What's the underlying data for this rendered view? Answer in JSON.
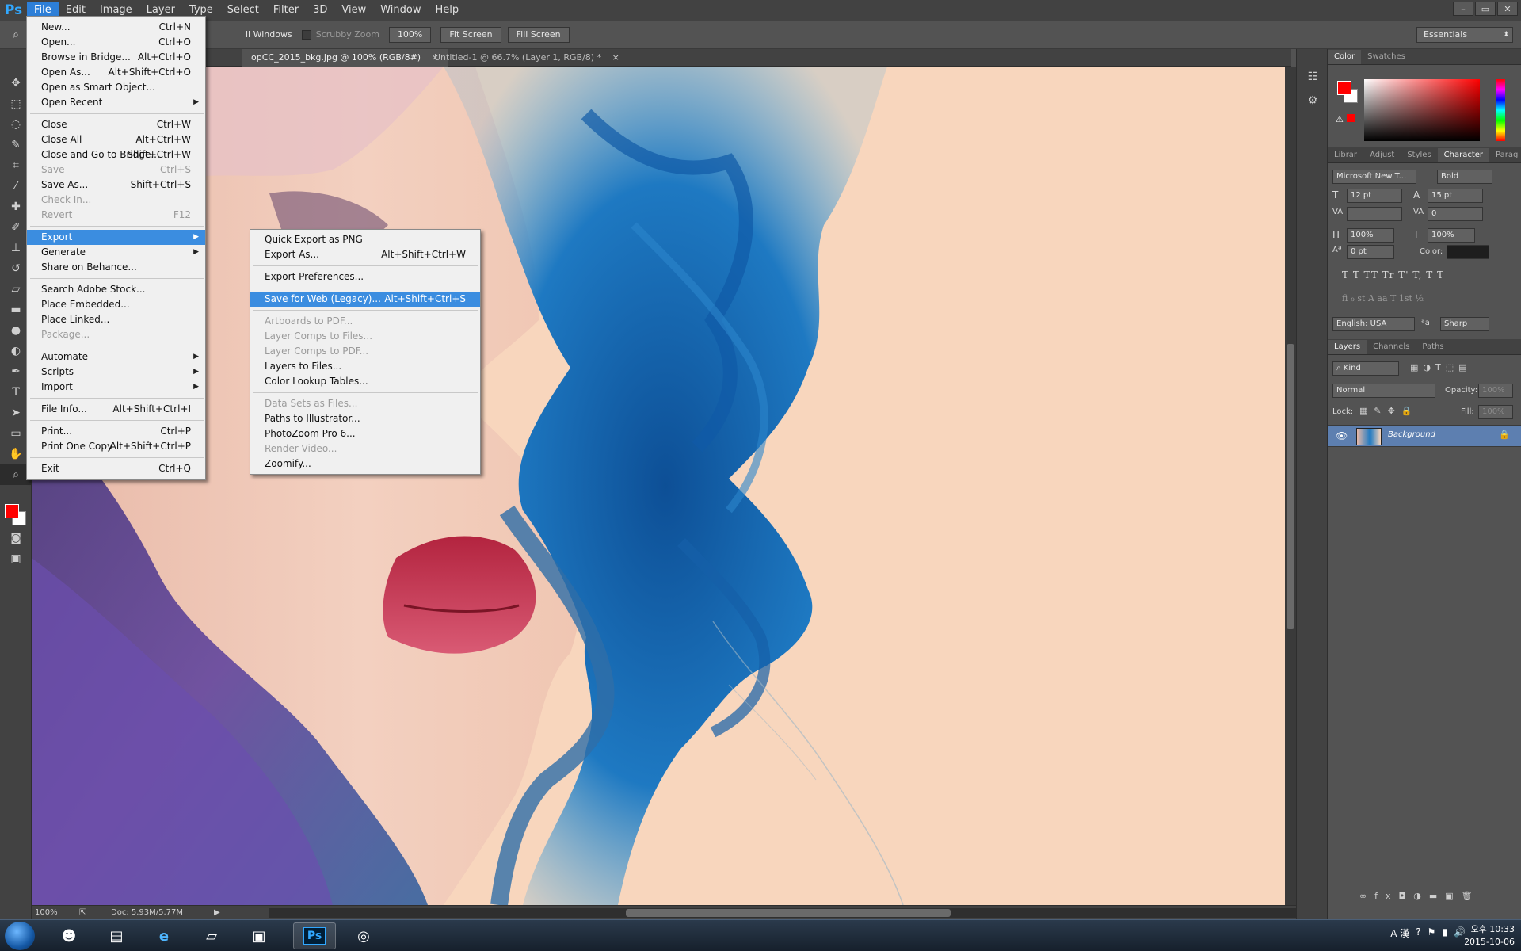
{
  "app": {
    "logo": "Ps"
  },
  "menubar": {
    "items": [
      "File",
      "Edit",
      "Image",
      "Layer",
      "Type",
      "Select",
      "Filter",
      "3D",
      "View",
      "Window",
      "Help"
    ],
    "window_buttons": [
      "–",
      "▭",
      "✕"
    ]
  },
  "options": {
    "all_windows": "ll Windows",
    "scrubby_zoom": "Scrubby Zoom",
    "zoom_btn": "100%",
    "fit_screen": "Fit Screen",
    "fill_screen": "Fill Screen",
    "workspace": "Essentials"
  },
  "tabs": [
    {
      "label": "opCC_2015_bkg.jpg @ 100% (RGB/8#)",
      "close": "×"
    },
    {
      "label": "Untitled-1 @ 66.7% (Layer 1, RGB/8) *",
      "close": "×"
    }
  ],
  "status": {
    "zoom": "100%",
    "doc": "Doc: 5.93M/5.77M"
  },
  "file_menu": [
    {
      "label": "New...",
      "shortcut": "Ctrl+N"
    },
    {
      "label": "Open...",
      "shortcut": "Ctrl+O"
    },
    {
      "label": "Browse in Bridge...",
      "shortcut": "Alt+Ctrl+O"
    },
    {
      "label": "Open As...",
      "shortcut": "Alt+Shift+Ctrl+O"
    },
    {
      "label": "Open as Smart Object...",
      "shortcut": ""
    },
    {
      "label": "Open Recent",
      "shortcut": ""
    },
    {
      "label": "Close",
      "shortcut": "Ctrl+W"
    },
    {
      "label": "Close All",
      "shortcut": "Alt+Ctrl+W"
    },
    {
      "label": "Close and Go to Bridge...",
      "shortcut": "Shift+Ctrl+W"
    },
    {
      "label": "Save",
      "shortcut": "Ctrl+S"
    },
    {
      "label": "Save As...",
      "shortcut": "Shift+Ctrl+S"
    },
    {
      "label": "Check In...",
      "shortcut": ""
    },
    {
      "label": "Revert",
      "shortcut": "F12"
    },
    {
      "label": "Export",
      "shortcut": ""
    },
    {
      "label": "Generate",
      "shortcut": ""
    },
    {
      "label": "Share on Behance...",
      "shortcut": ""
    },
    {
      "label": "Search Adobe Stock...",
      "shortcut": ""
    },
    {
      "label": "Place Embedded...",
      "shortcut": ""
    },
    {
      "label": "Place Linked...",
      "shortcut": ""
    },
    {
      "label": "Package...",
      "shortcut": ""
    },
    {
      "label": "Automate",
      "shortcut": ""
    },
    {
      "label": "Scripts",
      "shortcut": ""
    },
    {
      "label": "Import",
      "shortcut": ""
    },
    {
      "label": "File Info...",
      "shortcut": "Alt+Shift+Ctrl+I"
    },
    {
      "label": "Print...",
      "shortcut": "Ctrl+P"
    },
    {
      "label": "Print One Copy",
      "shortcut": "Alt+Shift+Ctrl+P"
    },
    {
      "label": "Exit",
      "shortcut": "Ctrl+Q"
    }
  ],
  "export_menu": [
    {
      "label": "Quick Export as PNG",
      "shortcut": ""
    },
    {
      "label": "Export As...",
      "shortcut": "Alt+Shift+Ctrl+W"
    },
    {
      "label": "Export Preferences...",
      "shortcut": ""
    },
    {
      "label": "Save for Web (Legacy)...",
      "shortcut": "Alt+Shift+Ctrl+S"
    },
    {
      "label": "Artboards to PDF...",
      "shortcut": ""
    },
    {
      "label": "Layer Comps to Files...",
      "shortcut": ""
    },
    {
      "label": "Layer Comps to PDF...",
      "shortcut": ""
    },
    {
      "label": "Layers to Files...",
      "shortcut": ""
    },
    {
      "label": "Color Lookup Tables...",
      "shortcut": ""
    },
    {
      "label": "Data Sets as Files...",
      "shortcut": ""
    },
    {
      "label": "Paths to Illustrator...",
      "shortcut": ""
    },
    {
      "label": "PhotoZoom Pro 6...",
      "shortcut": ""
    },
    {
      "label": "Render Video...",
      "shortcut": ""
    },
    {
      "label": "Zoomify...",
      "shortcut": ""
    }
  ],
  "panels": {
    "color_tabs": [
      "Color",
      "Swatches"
    ],
    "char_tabs": [
      "Librar",
      "Adjust",
      "Styles",
      "Character",
      "Parag"
    ],
    "font_family": "Microsoft New T...",
    "font_style": "Bold",
    "font_size": "12 pt",
    "leading": "15 pt",
    "tracking": "0",
    "vscale": "100%",
    "hscale": "100%",
    "baseline": "0 pt",
    "color_label": "Color:",
    "type_styles": "T  T  TT  Tr  T'  T,  T  T",
    "ot_features": "fi  ℴ  st  A  aa  T  1st  ½",
    "language": "English: USA",
    "aa_label": "ªa",
    "antialias": "Sharp",
    "layer_tabs": [
      "Layers",
      "Channels",
      "Paths"
    ],
    "kind": "Kind",
    "blend": "Normal",
    "opacity_label": "Opacity:",
    "opacity": "100%",
    "lock_label": "Lock:",
    "fill_label": "Fill:",
    "fill": "100%",
    "layer_name": "Background"
  },
  "taskbar": {
    "ps_label": "Ps",
    "tray_text": "A 漢",
    "time": "오후 10:33",
    "date": "2015-10-06"
  },
  "colors": {
    "foreground": "#ff0000",
    "background": "#ffffff",
    "menu_highlight": "#3b8de0"
  }
}
